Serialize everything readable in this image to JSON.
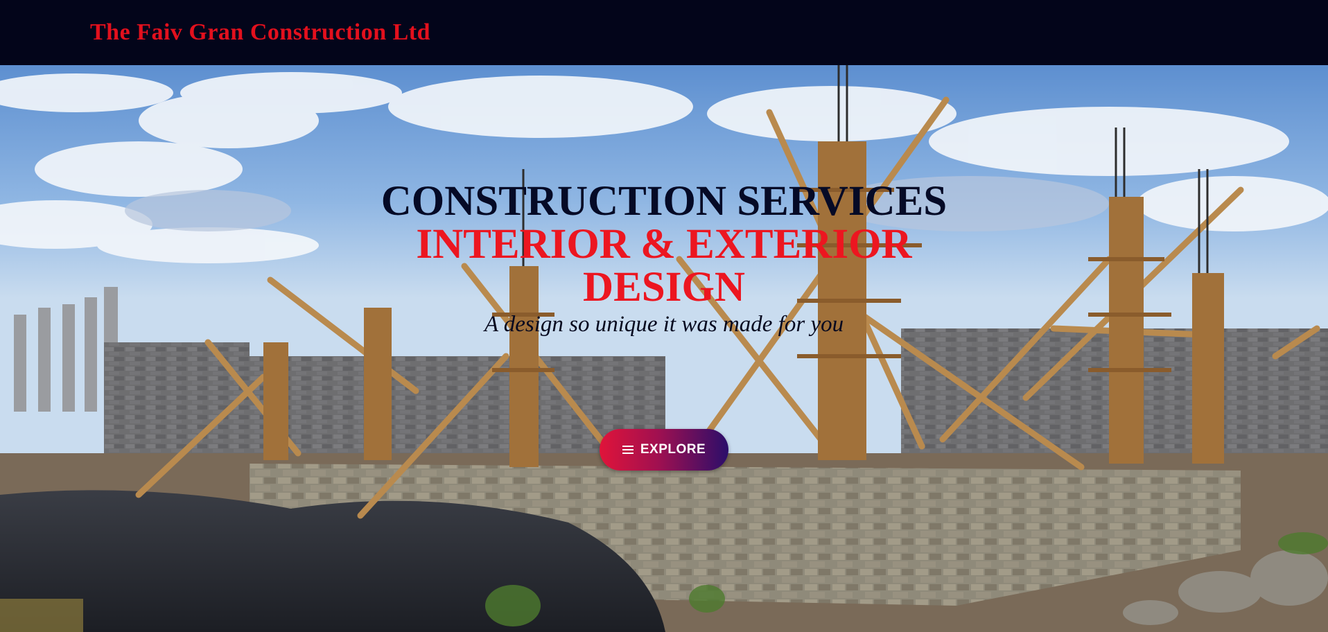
{
  "navbar": {
    "brand": "The Faiv Gran Construction Ltd"
  },
  "hero": {
    "line1": "CONSTRUCTION SERVICES",
    "line2": "INTERIOR & EXTERIOR",
    "line3": "DESIGN",
    "tagline": "A design so unique it was made for you",
    "button_label": "EXPLORE",
    "button_icon": "menu-icon",
    "background": "construction site with timber formwork"
  },
  "colors": {
    "navbar_bg": "#03051a",
    "brand": "#e3101d",
    "headline_dark": "#050a26",
    "headline_red": "#ec1620",
    "button_start": "#e0143a",
    "button_end": "#2b0e6a"
  }
}
